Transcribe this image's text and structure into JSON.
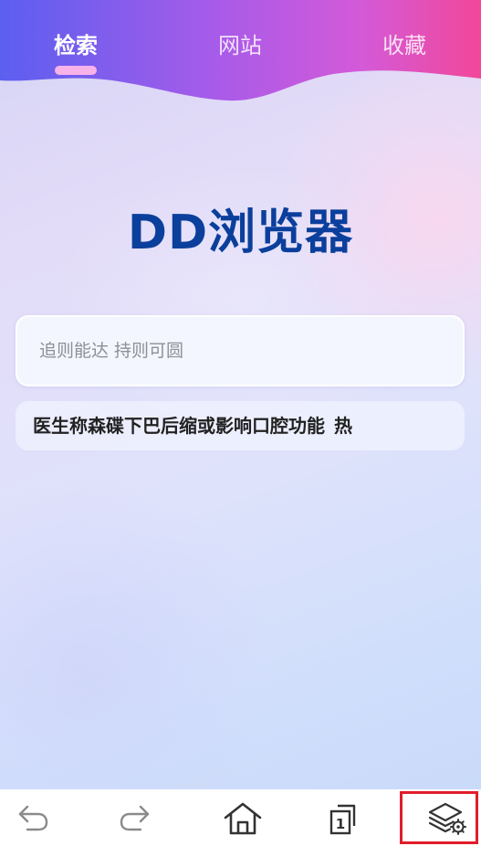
{
  "tabs": [
    {
      "label": "检索",
      "active": true
    },
    {
      "label": "网站",
      "active": false
    },
    {
      "label": "收藏",
      "active": false
    }
  ],
  "app": {
    "title": "DD浏览器"
  },
  "search": {
    "placeholder": "追则能达 持则可圆",
    "value": ""
  },
  "hot_list": [
    {
      "text": "医生称森碟下巴后缩或影响口腔功能",
      "badge": "热"
    }
  ],
  "bottom_nav": {
    "items": [
      {
        "name": "back",
        "icon": "undo-arrow-icon"
      },
      {
        "name": "forward",
        "icon": "redo-arrow-icon"
      },
      {
        "name": "home",
        "icon": "home-icon"
      },
      {
        "name": "tabs",
        "icon": "tab-count-icon",
        "count": "1"
      },
      {
        "name": "menu",
        "icon": "layers-gear-icon"
      }
    ]
  },
  "colors": {
    "title": "#0b3f9c",
    "tab_indicator": "#f7b2ea",
    "header_gradient_start": "#5b5ff0",
    "header_gradient_mid": "#b15ae8",
    "header_gradient_end": "#f2479a",
    "highlight": "#e01e2a",
    "icon": "#333333"
  }
}
